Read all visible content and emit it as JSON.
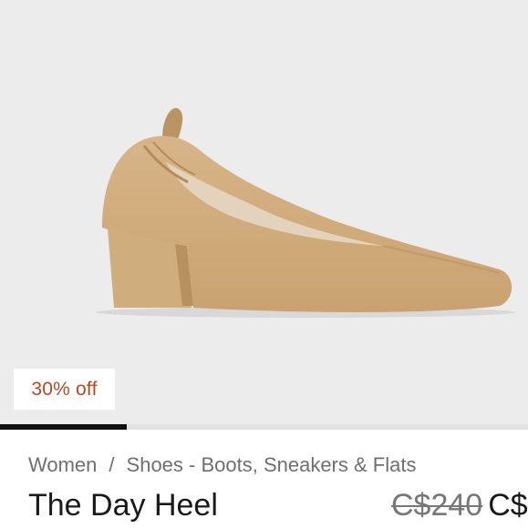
{
  "product_image": {
    "alt_icon": "heel-shoe-image",
    "background": "#ececec"
  },
  "badge": {
    "label": "30% off",
    "color": "#b8471f"
  },
  "gallery": {
    "progress": 0.24
  },
  "breadcrumb": {
    "items": [
      "Women",
      "Shoes - Boots, Sneakers & Flats"
    ],
    "separator": "/"
  },
  "product": {
    "title": "The Day Heel",
    "original_price": "C$240",
    "sale_price": "C$"
  }
}
